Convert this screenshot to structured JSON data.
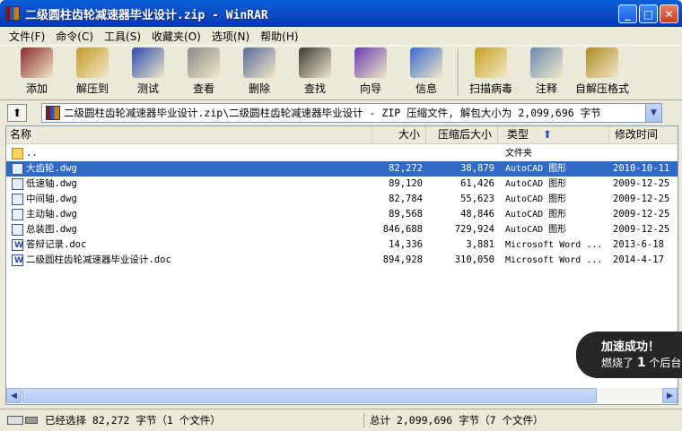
{
  "window": {
    "title": "二级圆柱齿轮减速器毕业设计.zip - WinRAR",
    "buttons": [
      "_",
      "□",
      "✕"
    ]
  },
  "menu": [
    "文件(F)",
    "命令(C)",
    "工具(S)",
    "收藏夹(O)",
    "选项(N)",
    "帮助(H)"
  ],
  "toolbar": [
    {
      "label": "添加",
      "icon": "add-books-icon",
      "color": "#8a2a2a"
    },
    {
      "label": "解压到",
      "icon": "extract-folder-icon",
      "color": "#c89a2a"
    },
    {
      "label": "测试",
      "icon": "test-book-icon",
      "color": "#2a4ab0"
    },
    {
      "label": "查看",
      "icon": "view-glasses-icon",
      "color": "#8a8a8a"
    },
    {
      "label": "删除",
      "icon": "delete-icon",
      "color": "#5a6a9a"
    },
    {
      "label": "查找",
      "icon": "binoculars-icon",
      "color": "#3a3a3a"
    },
    {
      "label": "向导",
      "icon": "wizard-icon",
      "color": "#6a3ab0"
    },
    {
      "label": "信息",
      "icon": "info-icon",
      "color": "#3a6ad0"
    },
    {
      "label": "扫描病毒",
      "icon": "virus-scan-icon",
      "color": "#c8a020"
    },
    {
      "label": "注释",
      "icon": "comment-icon",
      "color": "#6a8ab0"
    },
    {
      "label": "自解压格式",
      "icon": "sfx-box-icon",
      "color": "#b08a20"
    }
  ],
  "address": {
    "path": "二级圆柱齿轮减速器毕业设计.zip\\二级圆柱齿轮减速器毕业设计 - ZIP 压缩文件, 解包大小为 2,099,696 字节"
  },
  "columns": [
    "名称",
    "大小",
    "压缩后大小",
    "类型",
    "修改时间"
  ],
  "files": [
    {
      "name": "..",
      "size": "",
      "packed": "",
      "type": "文件夹",
      "modified": "",
      "icon": "folder-icon",
      "selected": false
    },
    {
      "name": "大齿轮.dwg",
      "size": "82,272",
      "packed": "38,879",
      "type": "AutoCAD 图形",
      "modified": "2010-10-11",
      "icon": "dwg-file-icon",
      "selected": true
    },
    {
      "name": "低速轴.dwg",
      "size": "89,120",
      "packed": "61,426",
      "type": "AutoCAD 图形",
      "modified": "2009-12-25",
      "icon": "dwg-file-icon",
      "selected": false
    },
    {
      "name": "中间轴.dwg",
      "size": "82,784",
      "packed": "55,623",
      "type": "AutoCAD 图形",
      "modified": "2009-12-25",
      "icon": "dwg-file-icon",
      "selected": false
    },
    {
      "name": "主动轴.dwg",
      "size": "89,568",
      "packed": "48,846",
      "type": "AutoCAD 图形",
      "modified": "2009-12-25",
      "icon": "dwg-file-icon",
      "selected": false
    },
    {
      "name": "总装图.dwg",
      "size": "846,688",
      "packed": "729,924",
      "type": "AutoCAD 图形",
      "modified": "2009-12-25",
      "icon": "dwg-file-icon",
      "selected": false
    },
    {
      "name": "答辩记录.doc",
      "size": "14,336",
      "packed": "3,881",
      "type": "Microsoft Word ...",
      "modified": "2013-6-18",
      "icon": "doc-file-icon",
      "selected": false
    },
    {
      "name": "二级圆柱齿轮减速器毕业设计.doc",
      "size": "894,928",
      "packed": "310,050",
      "type": "Microsoft Word ...",
      "modified": "2014-4-17",
      "icon": "doc-file-icon",
      "selected": false
    }
  ],
  "toast": {
    "title": "加速成功！",
    "msg_prefix": "燃烧了",
    "msg_number": "1",
    "msg_suffix": "个后台"
  },
  "status": {
    "left": "已经选择 82,272 字节（1 个文件）",
    "right": "总计 2,099,696 字节（7 个文件）"
  }
}
